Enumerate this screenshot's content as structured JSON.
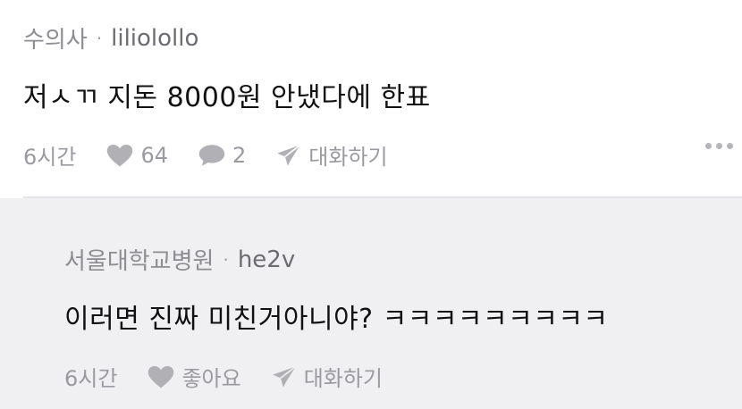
{
  "post": {
    "school": "수의사",
    "separator": "·",
    "username": "liliolollo",
    "text": "저ㅅㄲ 지돈 8000원 안냈다에 한표",
    "time": "6시간",
    "likes": "64",
    "comments": "2",
    "chat_label": "대화하기"
  },
  "reply": {
    "school": "서울대학교병원",
    "separator": "·",
    "username": "he2v",
    "text": "이러면 진짜 미친거아니야? ㅋㅋㅋㅋㅋㅋㅋㅋㅋ",
    "time": "6시간",
    "like_label": "좋아요",
    "chat_label": "대화하기"
  },
  "colors": {
    "reply_background": "#f0f0f2",
    "meta_text": "#8d8d92",
    "action_icon": "#b0b0b5"
  },
  "icons": [
    "heart-icon",
    "comment-icon",
    "send-icon",
    "more-icon"
  ]
}
